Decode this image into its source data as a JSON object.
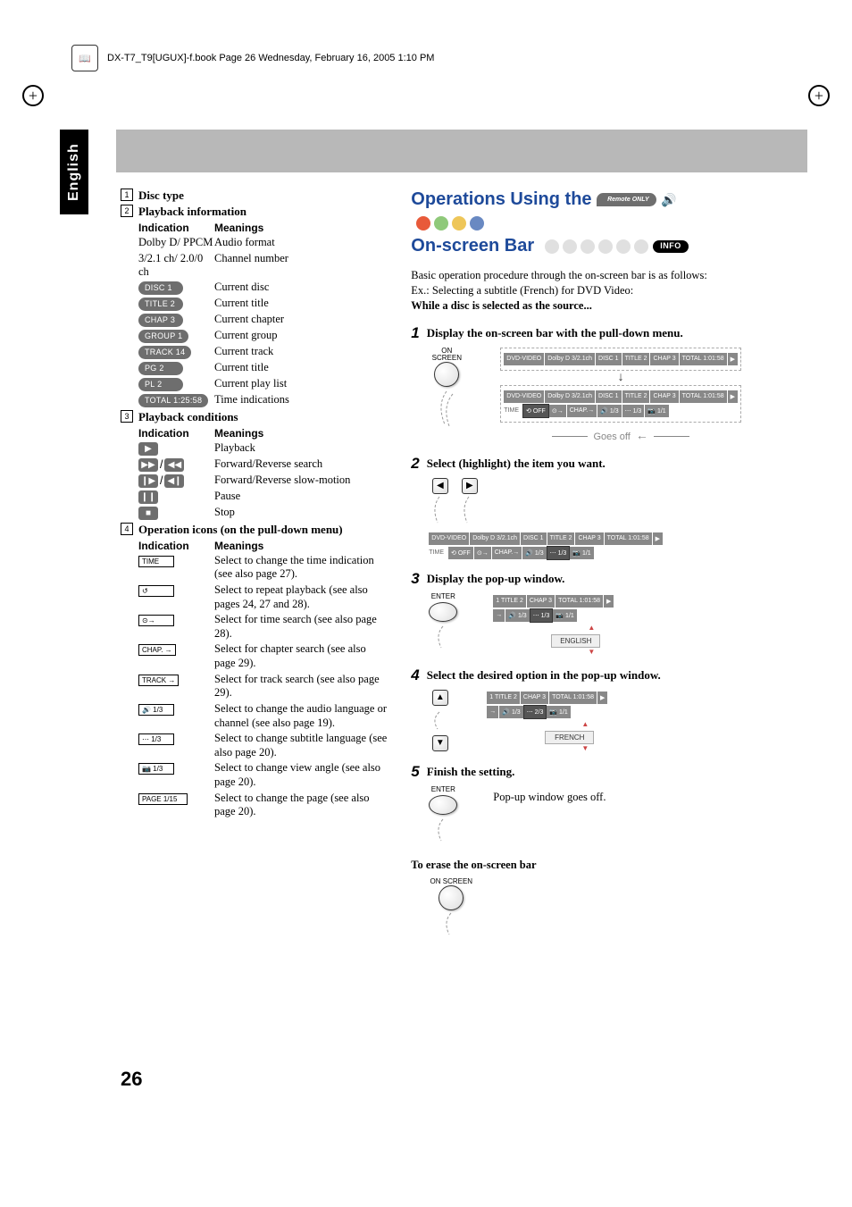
{
  "meta": {
    "book_info": "DX-T7_T9[UGUX]-f.book  Page 26  Wednesday, February 16, 2005  1:10 PM",
    "language_tab": "English",
    "page_number": "26"
  },
  "left": {
    "sec1": {
      "num": "1",
      "title": "Disc type"
    },
    "sec2": {
      "num": "2",
      "title": "Playback information",
      "headerA": "Indication",
      "headerB": "Meanings",
      "rows": [
        {
          "ind": "Dolby D/ PPCM",
          "mean": "Audio format",
          "type": "text"
        },
        {
          "ind": "3/2.1 ch/ 2.0/0 ch",
          "mean": "Channel number",
          "type": "text"
        },
        {
          "ind": "DISC  1",
          "mean": "Current disc",
          "type": "pill"
        },
        {
          "ind": "TITLE  2",
          "mean": "Current title",
          "type": "pill"
        },
        {
          "ind": "CHAP  3",
          "mean": "Current chapter",
          "type": "pill"
        },
        {
          "ind": "GROUP 1",
          "mean": "Current group",
          "type": "pill"
        },
        {
          "ind": "TRACK 14",
          "mean": "Current track",
          "type": "pill"
        },
        {
          "ind": "PG     2",
          "mean": "Current title",
          "type": "pill"
        },
        {
          "ind": "PL     2",
          "mean": "Current play list",
          "type": "pill"
        },
        {
          "ind": "TOTAL 1:25:58",
          "mean": "Time indications",
          "type": "pill"
        }
      ]
    },
    "sec3": {
      "num": "3",
      "title": "Playback conditions",
      "headerA": "Indication",
      "headerB": "Meanings",
      "rows": [
        {
          "mean": "Playback",
          "icon": "play"
        },
        {
          "mean": "Forward/Reverse search",
          "icon": "ffrw"
        },
        {
          "mean": "Forward/Reverse slow-motion",
          "icon": "slow"
        },
        {
          "mean": "Pause",
          "icon": "pause"
        },
        {
          "mean": "Stop",
          "icon": "stop"
        }
      ]
    },
    "sec4": {
      "num": "4",
      "title": "Operation icons (on the pull-down menu)",
      "headerA": "Indication",
      "headerB": "Meanings",
      "rows": [
        {
          "ind": "TIME",
          "mean": "Select to change the time indication (see also page 27)."
        },
        {
          "ind": "↺",
          "mean": "Select to repeat playback (see also pages 24, 27 and 28)."
        },
        {
          "ind": "⊙→",
          "mean": "Select for time search (see also page 28)."
        },
        {
          "ind": "CHAP. →",
          "mean": "Select for chapter search (see also page 29)."
        },
        {
          "ind": "TRACK →",
          "mean": "Select for track search (see also page 29)."
        },
        {
          "ind": "🔊 1/3",
          "mean": "Select to change the audio language or channel (see also page 19)."
        },
        {
          "ind": "⋯ 1/3",
          "mean": "Select to change subtitle language (see also page 20)."
        },
        {
          "ind": "📷 1/3",
          "mean": "Select to change view angle (see also page 20)."
        },
        {
          "ind": "PAGE 1/15",
          "mean": "Select to change the page (see also page 20)."
        }
      ]
    }
  },
  "right": {
    "title_line1": "Operations Using the",
    "title_line2": "On-screen Bar",
    "remote_badge": "Remote ONLY",
    "info_badge": "INFO",
    "intro1": "Basic operation procedure through the on-screen bar is as follows:",
    "intro2": "Ex.: Selecting a subtitle (French) for DVD Video:",
    "intro3": "While a disc is selected as the source...",
    "steps": [
      {
        "n": "1",
        "t": "Display the on-screen bar with the pull-down menu."
      },
      {
        "n": "2",
        "t": "Select (highlight) the item you want."
      },
      {
        "n": "3",
        "t": "Display the pop-up window."
      },
      {
        "n": "4",
        "t": "Select the desired option in the pop-up window."
      },
      {
        "n": "5",
        "t": "Finish the setting."
      }
    ],
    "btn_onscreen": "ON SCREEN",
    "btn_enter": "ENTER",
    "goes_off_label": "Goes off",
    "popup_finish_text": "Pop-up window goes off.",
    "erase_heading": "To erase the on-screen bar",
    "osd": {
      "dvd": "DVD-VIDEO",
      "dolby": "Dolby D 3/2.1ch",
      "disc": "DISC  1",
      "title": "TITLE  2",
      "chap": "CHAP  3",
      "total": "TOTAL  1:01:58",
      "time": "TIME",
      "off": "⟲ OFF",
      "timesearch": "⊙→",
      "chapsearch": "CHAP.→",
      "audio": "🔊 1/3",
      "sub": "⋯ 1/3",
      "angle": "📷 1/1",
      "title2": "1  TITLE  2",
      "sub2": "⋯ 2/3",
      "popup_en": "ENGLISH",
      "popup_fr": "FRENCH"
    }
  }
}
